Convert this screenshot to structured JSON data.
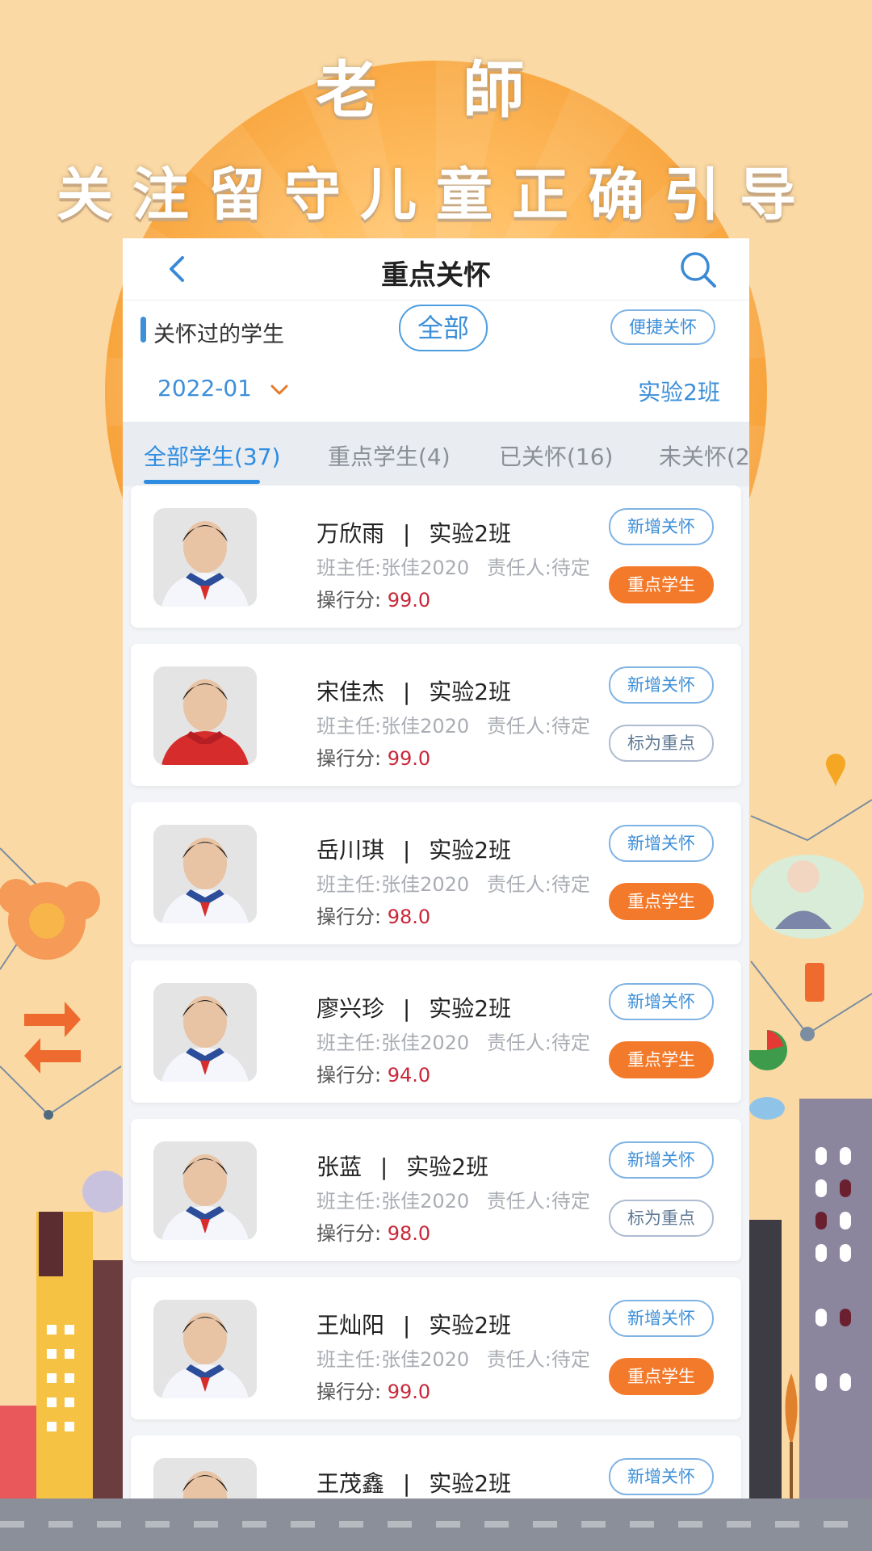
{
  "headline": {
    "line1": "老 師",
    "line2": "关注留守儿童正确引导"
  },
  "navbar": {
    "title": "重点关怀"
  },
  "filter": {
    "cared_label": "关怀过的学生",
    "all_pill": "全部",
    "quick_care_button": "便捷关怀",
    "date": "2022-01",
    "class_name": "实验2班"
  },
  "tabs": [
    {
      "label": "全部学生(37)"
    },
    {
      "label": "重点学生(4)"
    },
    {
      "label": "已关怀(16)"
    },
    {
      "label": "未关怀(2"
    }
  ],
  "labels": {
    "divider": "|",
    "teacher_prefix": "班主任:",
    "owner_prefix": "责任人:",
    "score_prefix": "操行分:",
    "add_care": "新增关怀",
    "key_student": "重点学生",
    "mark_key": "标为重点"
  },
  "students": [
    {
      "name": "万欣雨",
      "class": "实验2班",
      "teacher": "张佳2020",
      "owner": "待定",
      "score": "99.0",
      "status": "重点学生",
      "uniform": "white"
    },
    {
      "name": "宋佳杰",
      "class": "实验2班",
      "teacher": "张佳2020",
      "owner": "待定",
      "score": "99.0",
      "status": "标为重点",
      "uniform": "red"
    },
    {
      "name": "岳川琪",
      "class": "实验2班",
      "teacher": "张佳2020",
      "owner": "待定",
      "score": "98.0",
      "status": "重点学生",
      "uniform": "white"
    },
    {
      "name": "廖兴珍",
      "class": "实验2班",
      "teacher": "张佳2020",
      "owner": "待定",
      "score": "94.0",
      "status": "重点学生",
      "uniform": "white"
    },
    {
      "name": "张蓝",
      "class": "实验2班",
      "teacher": "张佳2020",
      "owner": "待定",
      "score": "98.0",
      "status": "标为重点",
      "uniform": "white"
    },
    {
      "name": "王灿阳",
      "class": "实验2班",
      "teacher": "张佳2020",
      "owner": "待定",
      "score": "99.0",
      "status": "重点学生",
      "uniform": "white"
    },
    {
      "name": "王茂鑫",
      "class": "实验2班",
      "teacher": "",
      "owner": "",
      "score": "",
      "status": "",
      "uniform": "white"
    }
  ],
  "colors": {
    "accent_blue": "#2e8de0",
    "orange": "#f47a2b",
    "score_red": "#c8283a"
  }
}
